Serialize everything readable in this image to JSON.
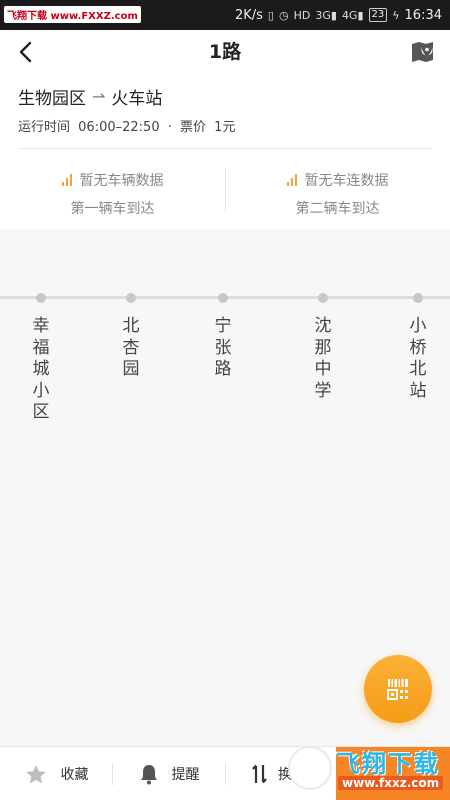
{
  "status_bar": {
    "watermark": "飞翔下载 www.FXXZ.com",
    "speed": "2K/s",
    "hd": "HD",
    "net1": "3G",
    "net2": "4G",
    "battery": "23",
    "time": "16:34"
  },
  "header": {
    "title": "1路"
  },
  "route": {
    "from": "生物园区",
    "to": "火车站",
    "hours_label": "运行时间",
    "hours": "06:00–22:50",
    "sep": "·",
    "fare_label": "票价",
    "fare": "1元"
  },
  "arrivals": [
    {
      "status": "暂无车辆数据",
      "label": "第一辆车到达"
    },
    {
      "status": "暂无车连数据",
      "label": "第二辆车到达"
    }
  ],
  "stops": [
    "幸福城小区",
    "北杏园",
    "宁张路",
    "沈那中学",
    "小桥北站"
  ],
  "bottom_bar": {
    "favorite": "收藏",
    "remind": "提醒",
    "reverse": "换"
  },
  "watermark": {
    "title": "飞翔下载",
    "url": "www.fxxz.com"
  },
  "colors": {
    "accent": "#f49c16",
    "bottom_accent": "#f58525",
    "signal": "#f4a43a"
  }
}
